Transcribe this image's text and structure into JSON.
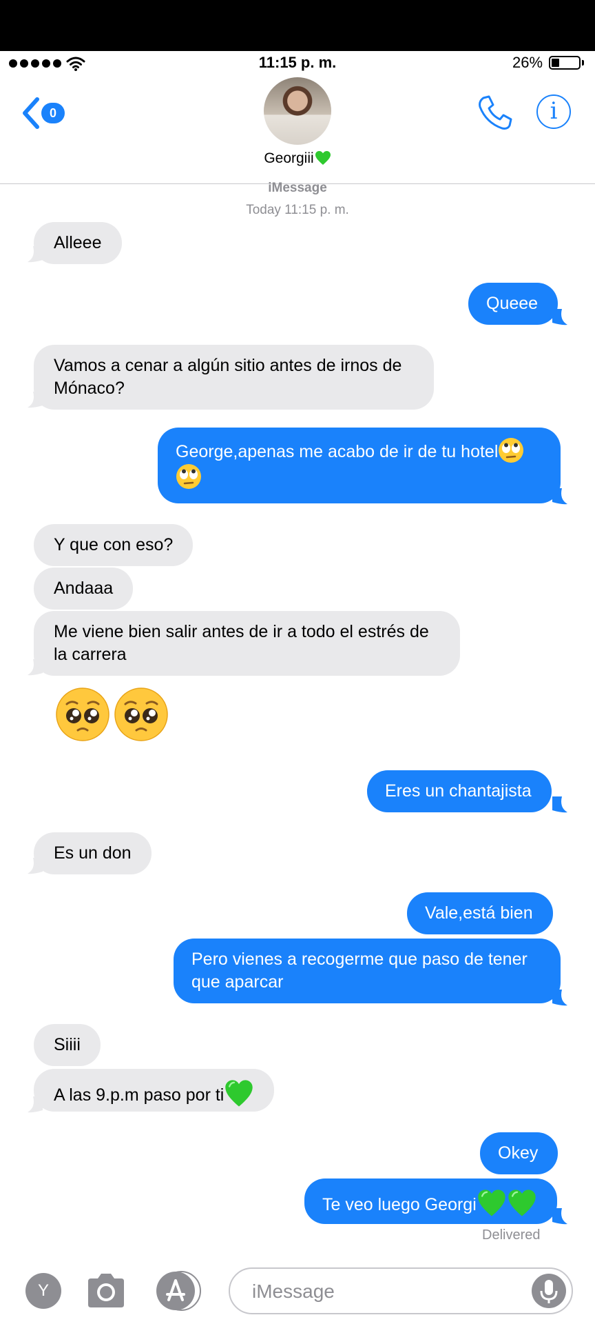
{
  "status_bar": {
    "time": "11:15 p. m.",
    "battery_pct": "26%",
    "battery_level": 0.26,
    "signal_bars": 5
  },
  "header": {
    "back_badge": "0",
    "contact_name": "Georgiii",
    "accent_color": "#1a82fb"
  },
  "conversation": {
    "service": "iMessage",
    "timestamp": "Today 11:15 p. m.",
    "messages": [
      {
        "from": "them",
        "text": "Alleee"
      },
      {
        "from": "me",
        "text": "Queee"
      },
      {
        "from": "them",
        "text": "Vamos a cenar a algún sitio antes de irnos de Mónaco?"
      },
      {
        "from": "me",
        "text": "George,apenas me acabo de ir de tu hotel",
        "emoji": "face-with-rolling-eyes"
      },
      {
        "from": "them",
        "text": "Y que con eso?"
      },
      {
        "from": "them",
        "text": "Andaaa"
      },
      {
        "from": "them",
        "text": "Me viene bien salir antes de ir a todo el estrés de la carrera"
      },
      {
        "from": "them",
        "emoji_only": "pleading-face x2"
      },
      {
        "from": "me",
        "text": "Eres un chantajista"
      },
      {
        "from": "them",
        "text": "Es un don"
      },
      {
        "from": "me",
        "text": "Vale,está bien"
      },
      {
        "from": "me",
        "text": "Pero vienes a recogerme que paso de tener que aparcar"
      },
      {
        "from": "them",
        "text": "Siiii"
      },
      {
        "from": "them",
        "text": "A las 9.p.m paso por ti",
        "emoji": "green-heart"
      },
      {
        "from": "me",
        "text": "Okey"
      },
      {
        "from": "me",
        "text": "Te veo luego Georgi",
        "emoji": "green-heart x2"
      }
    ],
    "delivered": "Delivered",
    "incoming_bubble_color": "#e9e9eb",
    "outgoing_bubble_color": "#1a82fb"
  },
  "composer": {
    "app_y_label": "Y",
    "placeholder": "iMessage"
  }
}
